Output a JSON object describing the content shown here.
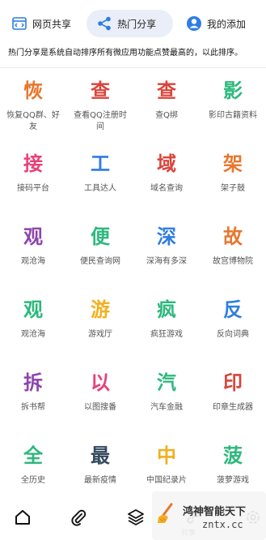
{
  "tabs": [
    {
      "label": "网页共享",
      "icon": "code-window-icon"
    },
    {
      "label": "热门分享",
      "icon": "share-icon"
    },
    {
      "label": "我的添加",
      "icon": "user-circle-icon"
    }
  ],
  "notice": "热门分享是系统自动排序所有微应用功能点赞最高的，以此排序。",
  "apps": [
    {
      "glyph": "恢",
      "label": "恢复QQ群、好友",
      "color": "#e8772e"
    },
    {
      "glyph": "查",
      "label": "查看QQ注册时间",
      "color": "#d9453b"
    },
    {
      "glyph": "查",
      "label": "查Q绑",
      "color": "#d9453b"
    },
    {
      "glyph": "影",
      "label": "影印古籍资料",
      "color": "#2db87d"
    },
    {
      "glyph": "接",
      "label": "接码平台",
      "color": "#e9407a"
    },
    {
      "glyph": "工",
      "label": "工具达人",
      "color": "#2f7de1"
    },
    {
      "glyph": "域",
      "label": "域名查询",
      "color": "#d9453b"
    },
    {
      "glyph": "架",
      "label": "架子鼓",
      "color": "#e8772e"
    },
    {
      "glyph": "观",
      "label": "观沧海",
      "color": "#8e44ad"
    },
    {
      "glyph": "便",
      "label": "便民查询网",
      "color": "#2db87d"
    },
    {
      "glyph": "深",
      "label": "深海有多深",
      "color": "#2f7de1"
    },
    {
      "glyph": "故",
      "label": "故宫博物院",
      "color": "#e8772e"
    },
    {
      "glyph": "观",
      "label": "观沧海",
      "color": "#2db87d"
    },
    {
      "glyph": "游",
      "label": "游戏厅",
      "color": "#f2b01e"
    },
    {
      "glyph": "疯",
      "label": "疯狂游戏",
      "color": "#2db87d"
    },
    {
      "glyph": "反",
      "label": "反向词典",
      "color": "#2f7de1"
    },
    {
      "glyph": "拆",
      "label": "拆书帮",
      "color": "#8e44ad"
    },
    {
      "glyph": "以",
      "label": "以图搜番",
      "color": "#e9407a"
    },
    {
      "glyph": "汽",
      "label": "汽车金融",
      "color": "#2db87d"
    },
    {
      "glyph": "印",
      "label": "印章生成器",
      "color": "#d9453b"
    },
    {
      "glyph": "全",
      "label": "全历史",
      "color": "#2db87d"
    },
    {
      "glyph": "最",
      "label": "最新疫情",
      "color": "#34495e"
    },
    {
      "glyph": "中",
      "label": "中国纪录片",
      "color": "#f2b01e"
    },
    {
      "glyph": "菠",
      "label": "菠萝游戏",
      "color": "#2db87d"
    }
  ],
  "bottom_nav": {
    "items": [
      {
        "icon": "home-icon"
      },
      {
        "icon": "paperclip-icon"
      },
      {
        "icon": "layers-icon"
      },
      {
        "icon": "link-icon"
      },
      {
        "icon": "settings-icon"
      }
    ],
    "partial_label": "共享"
  },
  "watermark": {
    "line1": "鸿神智能天下",
    "line2": "zntx.cc"
  },
  "colors": {
    "tab_active_bg": "#e9eef8",
    "icon_blue": "#2f7de1"
  }
}
